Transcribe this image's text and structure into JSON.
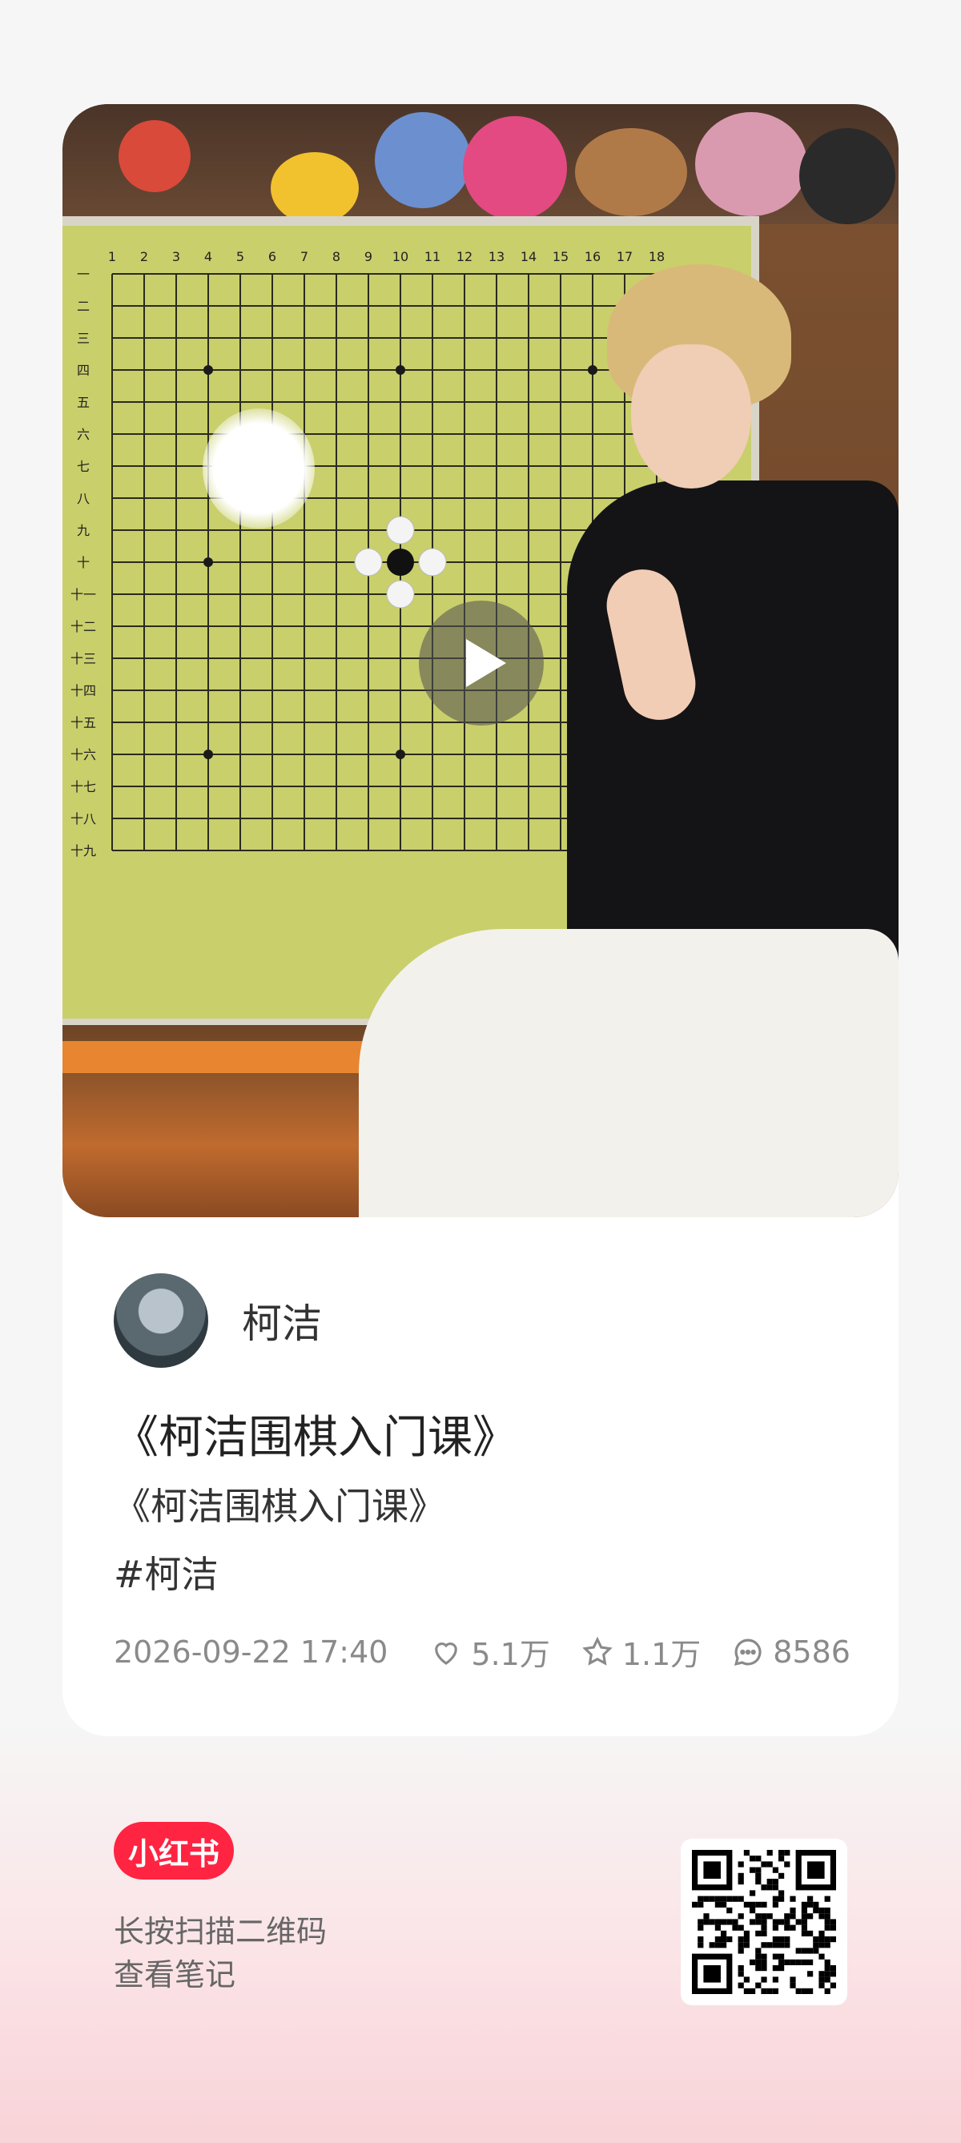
{
  "post": {
    "author_name": "柯洁",
    "title": "《柯洁围棋入门课》",
    "description": "《柯洁围棋入门课》",
    "tag": "#柯洁",
    "date": "2026-09-22 17:40",
    "likes": "5.1万",
    "favorites": "1.1万",
    "comments": "8586"
  },
  "board": {
    "column_labels": [
      "1",
      "2",
      "3",
      "4",
      "5",
      "6",
      "7",
      "8",
      "9",
      "10",
      "11",
      "12",
      "13",
      "14",
      "15",
      "16",
      "17",
      "18"
    ],
    "row_labels": [
      "一",
      "二",
      "三",
      "四",
      "五",
      "六",
      "七",
      "八",
      "九",
      "十",
      "十一",
      "十二",
      "十三",
      "十四",
      "十五",
      "十六",
      "十七",
      "十八",
      "十九"
    ]
  },
  "footer": {
    "brand": "小红书",
    "scan_hint_line1": "长按扫描二维码",
    "scan_hint_line2": "查看笔记"
  },
  "colors": {
    "brand_red": "#ff2442",
    "board_green": "#c9cf6b"
  },
  "icons": [
    "play-icon",
    "heart-icon",
    "star-icon",
    "comment-icon",
    "qr-code-icon"
  ]
}
